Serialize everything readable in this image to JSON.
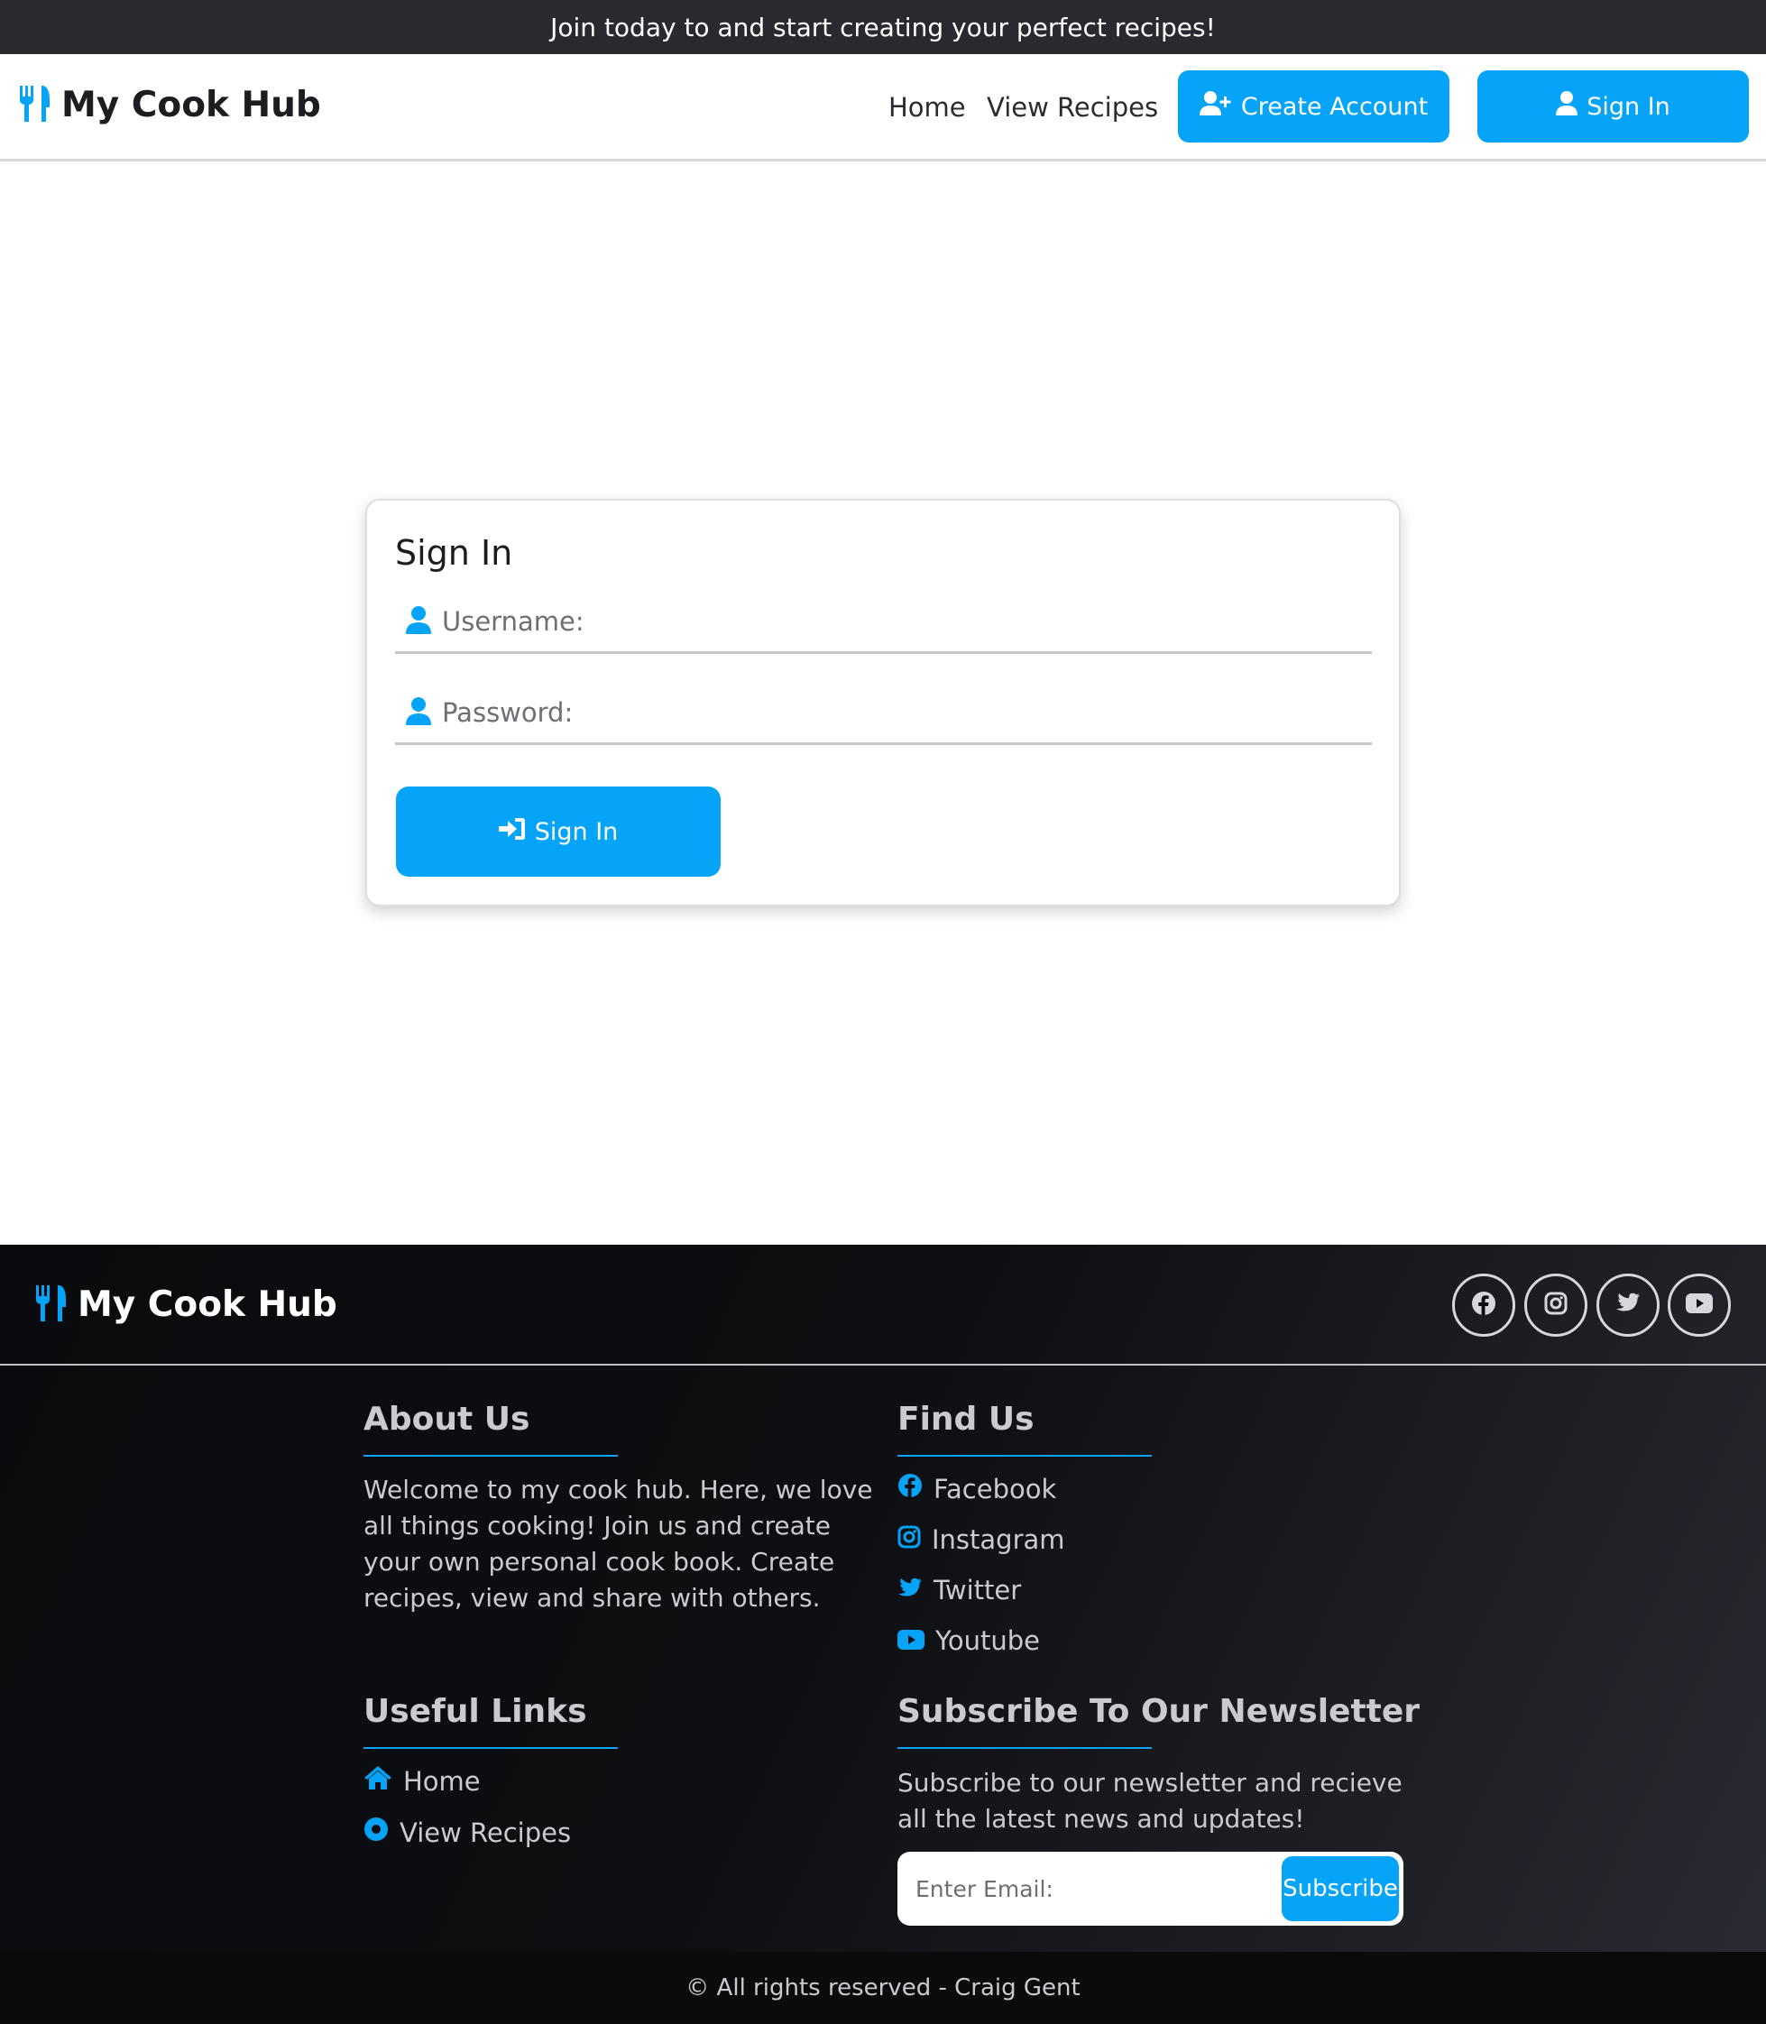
{
  "topbar": {
    "text": "Join today to and start creating your perfect recipes!"
  },
  "navbar": {
    "brand": "My Cook Hub",
    "links": [
      {
        "label": "Home"
      },
      {
        "label": "View Recipes"
      }
    ],
    "create_account_label": "Create Account",
    "sign_in_label": "Sign In"
  },
  "signin_form": {
    "title": "Sign In",
    "username_placeholder": "Username:",
    "password_placeholder": "Password:",
    "submit_label": "Sign In"
  },
  "footer": {
    "brand": "My Cook Hub",
    "social_icons": [
      "facebook-icon",
      "instagram-icon",
      "twitter-icon",
      "youtube-icon"
    ],
    "about": {
      "title": "About Us",
      "text": "Welcome to my cook hub. Here, we love all things cooking! Join us and create your own personal cook book. Create recipes, view and share with others."
    },
    "find_us": {
      "title": "Find Us",
      "links": [
        {
          "label": "Facebook"
        },
        {
          "label": "Instagram"
        },
        {
          "label": "Twitter"
        },
        {
          "label": "Youtube"
        }
      ]
    },
    "useful_links": {
      "title": "Useful Links",
      "links": [
        {
          "label": "Home"
        },
        {
          "label": "View Recipes"
        }
      ]
    },
    "newsletter": {
      "title": "Subscribe To Our Newsletter",
      "text": "Subscribe to our newsletter and recieve all the latest news and updates!",
      "email_placeholder": "Enter Email:",
      "subscribe_label": "Subscribe"
    },
    "copyright": "© All rights reserved - Craig Gent"
  },
  "colors": {
    "accent": "#05a4f8",
    "topbar_bg": "#282a30",
    "footer_bg": "#0d0e11"
  }
}
